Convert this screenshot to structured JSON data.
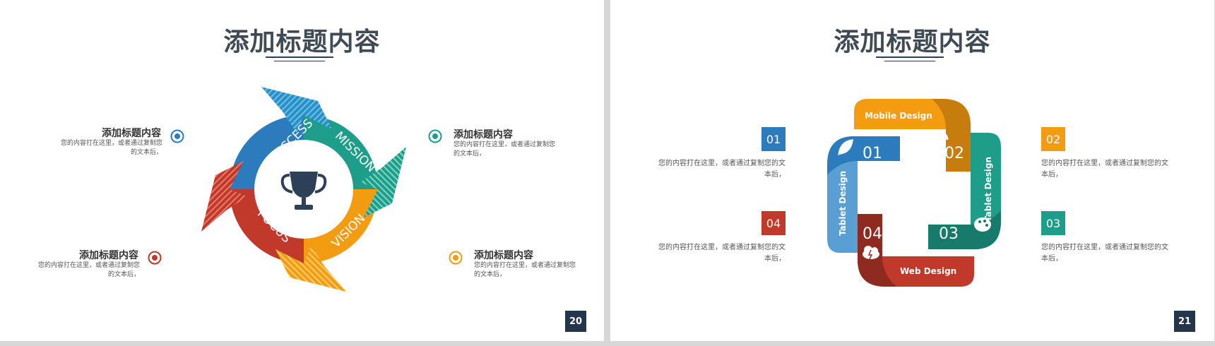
{
  "left_slide": {
    "title": "添加标题内容",
    "page_number": "20",
    "cycle_labels": [
      "SUCCESS",
      "MISSION",
      "VISION",
      "FOCUS"
    ],
    "items": [
      {
        "title": "添加标题内容",
        "desc_line1": "您的内容打在这里，或者通过复制您",
        "desc_line2": "的文本后，",
        "color": "#2b7bbd"
      },
      {
        "title": "添加标题内容",
        "desc_line1": "您的内容打在这里，或者通过复制您",
        "desc_line2": "的文本后，",
        "color": "#1e9e8a"
      },
      {
        "title": "添加标题内容",
        "desc_line1": "您的内容打在这里，或者通过复制您",
        "desc_line2": "的文本后，",
        "color": "#c0392b"
      },
      {
        "title": "添加标题内容",
        "desc_line1": "您的内容打在这里，或者通过复制您",
        "desc_line2": "的文本后，",
        "color": "#f39c12"
      }
    ]
  },
  "right_slide": {
    "title": "添加标题内容",
    "page_number": "21",
    "puzzle_labels": {
      "top": "Mobile Design",
      "right": "Tablet Design",
      "bottom": "Web Design",
      "left": "Tablet Design",
      "n1": "01",
      "n2": "02",
      "n3": "03",
      "n4": "04"
    },
    "items": [
      {
        "number": "01",
        "desc_line1": "您的内容打在这里，或者通过复制您的文",
        "desc_line2": "本后，",
        "color": "#2b7bbd"
      },
      {
        "number": "04",
        "desc_line1": "您的内容打在这里，或者通过复制您的文",
        "desc_line2": "本后，",
        "color": "#c0392b"
      },
      {
        "number": "02",
        "desc_line1": "您的内容打在这里，或者通过复制您的文",
        "desc_line2": "本后，",
        "color": "#f39c12"
      },
      {
        "number": "03",
        "desc_line1": "您的内容打在这里，或者通过复制您的文",
        "desc_line2": "本后，",
        "color": "#1e9e8a"
      }
    ]
  }
}
